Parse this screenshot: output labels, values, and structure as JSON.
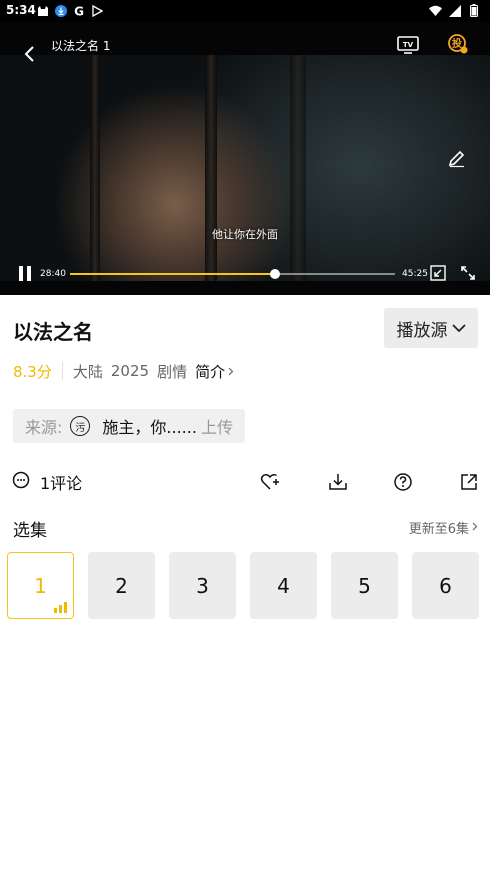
{
  "status_bar": {
    "time": "5:34",
    "left_icons": [
      "notification-cat-icon",
      "download-badge-icon",
      "google-g-icon",
      "play-store-icon"
    ],
    "right_icons": [
      "wifi-icon",
      "cell-signal-icon",
      "battery-icon"
    ]
  },
  "player": {
    "title": "以法之名 1",
    "subtitle": "他让你在外面",
    "current_time": "28:40",
    "total_time": "45:25",
    "progress": 0.63,
    "accent": "#f5c518"
  },
  "info": {
    "show_title": "以法之名",
    "source_button": "播放源",
    "score": "8.3分",
    "region": "大陆",
    "year": "2025",
    "genre": "剧情",
    "intro": "简介"
  },
  "source": {
    "label": "来源:",
    "avatar_text": "污",
    "uploader": "施主，你......",
    "upload_label": "上传"
  },
  "actions": {
    "comment_count": "1评论"
  },
  "episodes": {
    "title": "选集",
    "update_text": "更新至6集",
    "items": [
      "1",
      "2",
      "3",
      "4",
      "5",
      "6"
    ],
    "active_index": 0
  }
}
